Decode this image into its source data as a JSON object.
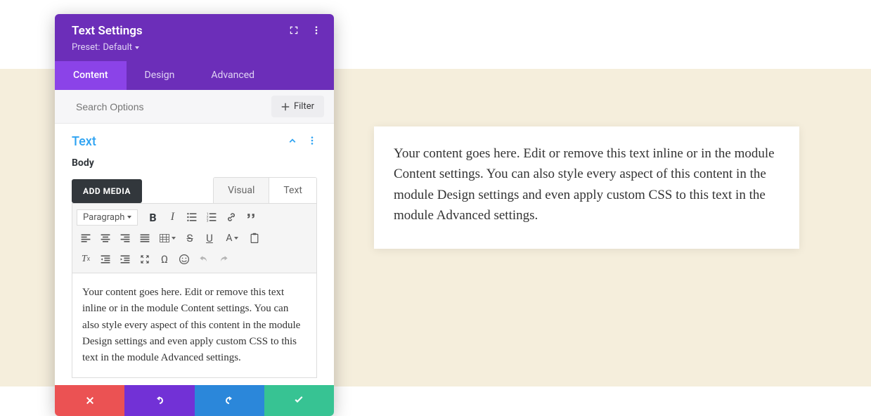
{
  "header": {
    "title": "Text Settings",
    "preset_label": "Preset:",
    "preset_value": "Default"
  },
  "tabs": {
    "content": "Content",
    "design": "Design",
    "advanced": "Advanced"
  },
  "search": {
    "placeholder": "Search Options",
    "filter_label": "Filter"
  },
  "section": {
    "title": "Text",
    "body_label": "Body",
    "add_media": "ADD MEDIA",
    "editor_tabs": {
      "visual": "Visual",
      "text": "Text"
    },
    "format_dropdown": "Paragraph",
    "letter_a": "A",
    "editor_content": "Your content goes here. Edit or remove this text inline or in the module Content settings. You can also style every aspect of this content in the module Design settings and even apply custom CSS to this text in the module Advanced settings."
  },
  "preview": {
    "text": "Your content goes here. Edit or remove this text inline or in the module Content settings. You can also style every aspect of this content in the module Design settings and even apply custom CSS to this text in the module Advanced settings."
  }
}
